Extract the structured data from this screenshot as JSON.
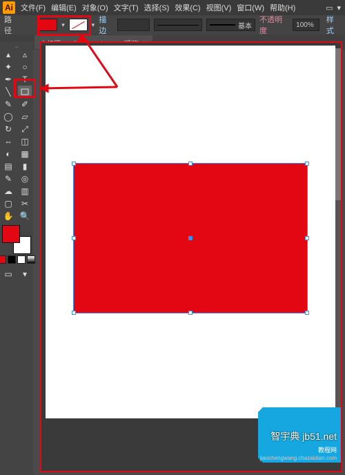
{
  "app": {
    "logo": "Ai"
  },
  "menu": {
    "file": "文件(F)",
    "edit": "编辑(E)",
    "object": "对象(O)",
    "type": "文字(T)",
    "select": "选择(S)",
    "effect": "效果(C)",
    "view": "视图(V)",
    "window": "窗口(W)",
    "help": "帮助(H)"
  },
  "control": {
    "mode_label": "路径",
    "stroke_label": "描边",
    "stroke_width": "",
    "style_basic": "基本",
    "opacity_label": "不透明度",
    "opacity_value": "100%",
    "style_label": "样式"
  },
  "document": {
    "tab_title": "未标题-1* @ 100% (CMYK/预览)"
  },
  "swatch_colors": {
    "fill": "#e30613",
    "stroke": "none"
  },
  "mini_swatches": [
    "#e30613",
    "#000000",
    "#ffffff",
    "#888888"
  ],
  "watermark": {
    "line1": "智宇典 jb51.net",
    "line2": "教程网",
    "line3": "jiaochengwang.chazaidian.com"
  }
}
